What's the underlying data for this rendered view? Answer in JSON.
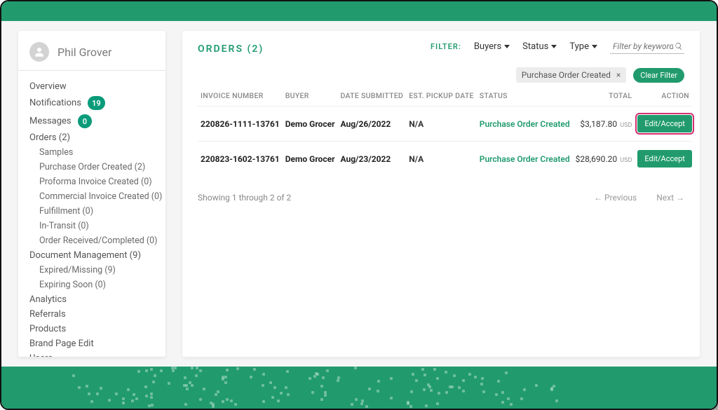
{
  "user": {
    "name": "Phil Grover"
  },
  "sidebar": {
    "items": {
      "overview": "Overview",
      "notifications": "Notifications",
      "notifications_badge": "19",
      "messages": "Messages",
      "messages_badge": "0",
      "orders": "Orders (2)",
      "samples": "Samples",
      "po_created": "Purchase Order Created (2)",
      "proforma": "Proforma Invoice Created (0)",
      "commercial": "Commercial Invoice Created (0)",
      "fulfillment": "Fulfillment (0)",
      "in_transit": "In-Transit (0)",
      "completed": "Order Received/Completed (0)",
      "doc_mgmt": "Document Management (9)",
      "expired": "Expired/Missing (9)",
      "expiring": "Expiring Soon (0)",
      "analytics": "Analytics",
      "referrals": "Referrals",
      "products": "Products",
      "brand_page": "Brand Page Edit",
      "users": "Users"
    }
  },
  "main": {
    "title": "ORDERS (2)",
    "filter_label": "FILTER:",
    "filters": {
      "buyers": "Buyers",
      "status": "Status",
      "type": "Type"
    },
    "search_placeholder": "Filter by keywords",
    "chip": "Purchase Order Created",
    "clear": "Clear Filter",
    "columns": {
      "invoice": "INVOICE NUMBER",
      "buyer": "BUYER",
      "date": "DATE SUBMITTED",
      "pickup": "EST. PICKUP DATE",
      "status": "STATUS",
      "total": "TOTAL",
      "action": "ACTION"
    },
    "rows": [
      {
        "invoice": "220826-1111-13761",
        "buyer": "Demo Grocer",
        "date": "Aug/26/2022",
        "pickup": "N/A",
        "status": "Purchase Order Created",
        "total": "$3,187.80",
        "currency": "USD",
        "action": "Edit/Accept",
        "highlight": true
      },
      {
        "invoice": "220823-1602-13761",
        "buyer": "Demo Grocer",
        "date": "Aug/23/2022",
        "pickup": "N/A",
        "status": "Purchase Order Created",
        "total": "$28,690.20",
        "currency": "USD",
        "action": "Edit/Accept",
        "highlight": false
      }
    ],
    "showing": "Showing 1 through 2 of 2",
    "prev": "← Previous",
    "next": "Next →"
  }
}
